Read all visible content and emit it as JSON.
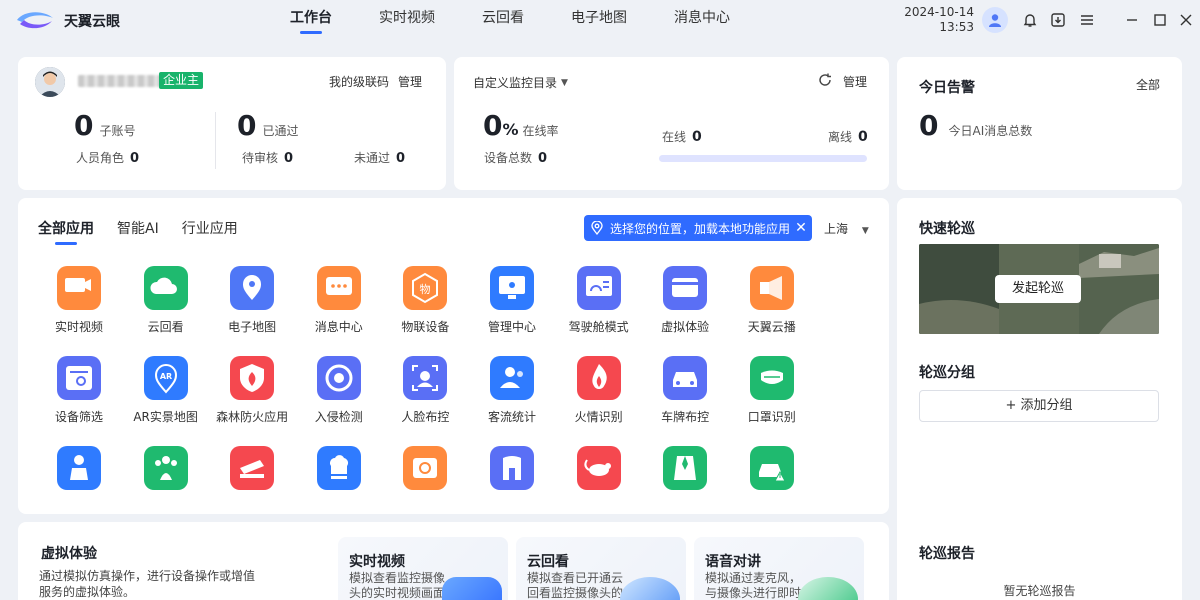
{
  "app": {
    "brand": "天翼云眼",
    "nav": [
      "工作台",
      "实时视频",
      "云回看",
      "电子地图",
      "消息中心"
    ],
    "date": "2024-10-14",
    "time": "13:53"
  },
  "account_card": {
    "badge": "企业主",
    "my_code": "我的级联码",
    "manage": "管理",
    "sub_count": "0",
    "sub_label": "子账号",
    "role_label": "人员角色",
    "role_count": "0",
    "passed_count": "0",
    "passed_label": "已通过",
    "pending_label": "待审核",
    "pending_count": "0",
    "rejected_label": "未通过",
    "rejected_count": "0"
  },
  "monitor_card": {
    "title": "自定义监控目录",
    "manage": "管理",
    "online_rate": "0",
    "percent": "%",
    "online_rate_label": "在线率",
    "total_label": "设备总数",
    "total_count": "0",
    "online_label": "在线",
    "online_count": "0",
    "offline_label": "离线",
    "offline_count": "0",
    "online_fraction": 0
  },
  "alarm_card": {
    "title": "今日告警",
    "all": "全部",
    "count": "0",
    "label": "今日AI消息总数"
  },
  "apps_card": {
    "tabs": [
      "全部应用",
      "智能AI",
      "行业应用"
    ],
    "location_banner": "选择您的位置，加载本地功能应用",
    "city": "上海",
    "apps": [
      {
        "label": "实时视频",
        "color": "#ff8a3d",
        "icon": "video-icon"
      },
      {
        "label": "云回看",
        "color": "#1fba6f",
        "icon": "cloud-icon"
      },
      {
        "label": "电子地图",
        "color": "#4f77f6",
        "icon": "map-pin-icon"
      },
      {
        "label": "消息中心",
        "color": "#ff8a3d",
        "icon": "message-icon"
      },
      {
        "label": "物联设备",
        "color": "#ff8a3d",
        "icon": "iot-icon"
      },
      {
        "label": "管理中心",
        "color": "#2f7bff",
        "icon": "monitor-icon"
      },
      {
        "label": "驾驶舱模式",
        "color": "#5a6ff5",
        "icon": "dashboard-icon"
      },
      {
        "label": "虚拟体验",
        "color": "#5a6ff5",
        "icon": "card-icon"
      },
      {
        "label": "天翼云播",
        "color": "#ff8a3d",
        "icon": "broadcast-icon"
      },
      {
        "label": "设备筛选",
        "color": "#5a6ff5",
        "icon": "filter-icon"
      },
      {
        "label": "AR实景地图",
        "color": "#2f7bff",
        "icon": "ar-icon"
      },
      {
        "label": "森林防火应用",
        "color": "#f5484f",
        "icon": "fire-shield-icon"
      },
      {
        "label": "入侵检测",
        "color": "#5a6ff5",
        "icon": "intrusion-icon"
      },
      {
        "label": "人脸布控",
        "color": "#5a6ff5",
        "icon": "face-icon"
      },
      {
        "label": "客流统计",
        "color": "#2f7bff",
        "icon": "people-icon"
      },
      {
        "label": "火情识别",
        "color": "#f5484f",
        "icon": "flame-icon"
      },
      {
        "label": "车牌布控",
        "color": "#5a6ff5",
        "icon": "car-icon"
      },
      {
        "label": "口罩识别",
        "color": "#1fba6f",
        "icon": "mask-icon"
      },
      {
        "label": "",
        "color": "#2f7bff",
        "icon": "child-icon"
      },
      {
        "label": "",
        "color": "#1fba6f",
        "icon": "crowd-icon"
      },
      {
        "label": "",
        "color": "#f5484f",
        "icon": "banner-icon"
      },
      {
        "label": "",
        "color": "#2f7bff",
        "icon": "chef-icon"
      },
      {
        "label": "",
        "color": "#ff8a3d",
        "icon": "scan-icon"
      },
      {
        "label": "",
        "color": "#5a6ff5",
        "icon": "door-icon"
      },
      {
        "label": "",
        "color": "#f5484f",
        "icon": "rat-icon"
      },
      {
        "label": "",
        "color": "#1fba6f",
        "icon": "suit-icon"
      },
      {
        "label": "",
        "color": "#1fba6f",
        "icon": "car-alert-icon"
      }
    ]
  },
  "virtual_card": {
    "title": "虚拟体验",
    "desc": "通过模拟仿真操作，进行设备操作或增值服务的虚拟体验。",
    "items": [
      {
        "title": "实时视频",
        "desc": "模拟查看监控摄像头的实时视频画面"
      },
      {
        "title": "云回看",
        "desc": "模拟查看已开通云回看监控摄像头的"
      },
      {
        "title": "语音对讲",
        "desc": "模拟通过麦克风，与摄像头进行即时"
      }
    ]
  },
  "quick_patrol": {
    "title": "快速轮巡",
    "button": "发起轮巡"
  },
  "patrol_group": {
    "title": "轮巡分组",
    "add": "+ 添加分组"
  },
  "patrol_report": {
    "title": "轮巡报告",
    "empty": "暂无轮巡报告"
  }
}
